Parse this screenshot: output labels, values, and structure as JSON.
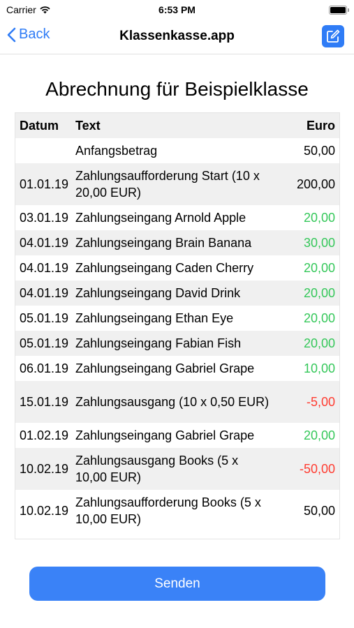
{
  "status": {
    "carrier": "Carrier",
    "time": "6:53 PM"
  },
  "nav": {
    "back_label": "Back",
    "title": "Klassenkasse.app"
  },
  "page_title": "Abrechnung für Beispielklasse",
  "table": {
    "headers": {
      "date": "Datum",
      "text": "Text",
      "amount": "Euro"
    },
    "rows": [
      {
        "date": "",
        "text": "Anfangsbetrag",
        "amount": "50,00",
        "type": "neutral"
      },
      {
        "date": "01.01.19",
        "text": "Zahlungsaufforderung Start (10 x 20,00 EUR)",
        "amount": "200,00",
        "type": "neutral"
      },
      {
        "date": "03.01.19",
        "text": "Zahlungseingang Arnold Apple",
        "amount": "20,00",
        "type": "positive"
      },
      {
        "date": "04.01.19",
        "text": "Zahlungseingang Brain Banana",
        "amount": "30,00",
        "type": "positive"
      },
      {
        "date": "04.01.19",
        "text": "Zahlungseingang Caden Cherry",
        "amount": "20,00",
        "type": "positive"
      },
      {
        "date": "04.01.19",
        "text": "Zahlungseingang David Drink",
        "amount": "20,00",
        "type": "positive"
      },
      {
        "date": "05.01.19",
        "text": "Zahlungseingang Ethan Eye",
        "amount": "20,00",
        "type": "positive"
      },
      {
        "date": "05.01.19",
        "text": "Zahlungseingang Fabian Fish",
        "amount": "20,00",
        "type": "positive"
      },
      {
        "date": "06.01.19",
        "text": "Zahlungseingang Gabriel Grape",
        "amount": "10,00",
        "type": "positive"
      },
      {
        "date": "15.01.19",
        "text": "Zahlungsausgang (10 x 0,50 EUR)",
        "amount": "-5,00",
        "type": "negative"
      },
      {
        "date": "01.02.19",
        "text": "Zahlungseingang Gabriel Grape",
        "amount": "20,00",
        "type": "positive"
      },
      {
        "date": "10.02.19",
        "text": "Zahlungsausgang Books (5 x 10,00 EUR)",
        "amount": "-50,00",
        "type": "negative"
      },
      {
        "date": "10.02.19",
        "text": "Zahlungsaufforderung Books (5 x 10,00 EUR)",
        "amount": "50,00",
        "type": "neutral"
      }
    ]
  },
  "send_label": "Senden",
  "colors": {
    "accent": "#2f7cf6",
    "positive": "#34c759",
    "negative": "#ff3b30"
  }
}
